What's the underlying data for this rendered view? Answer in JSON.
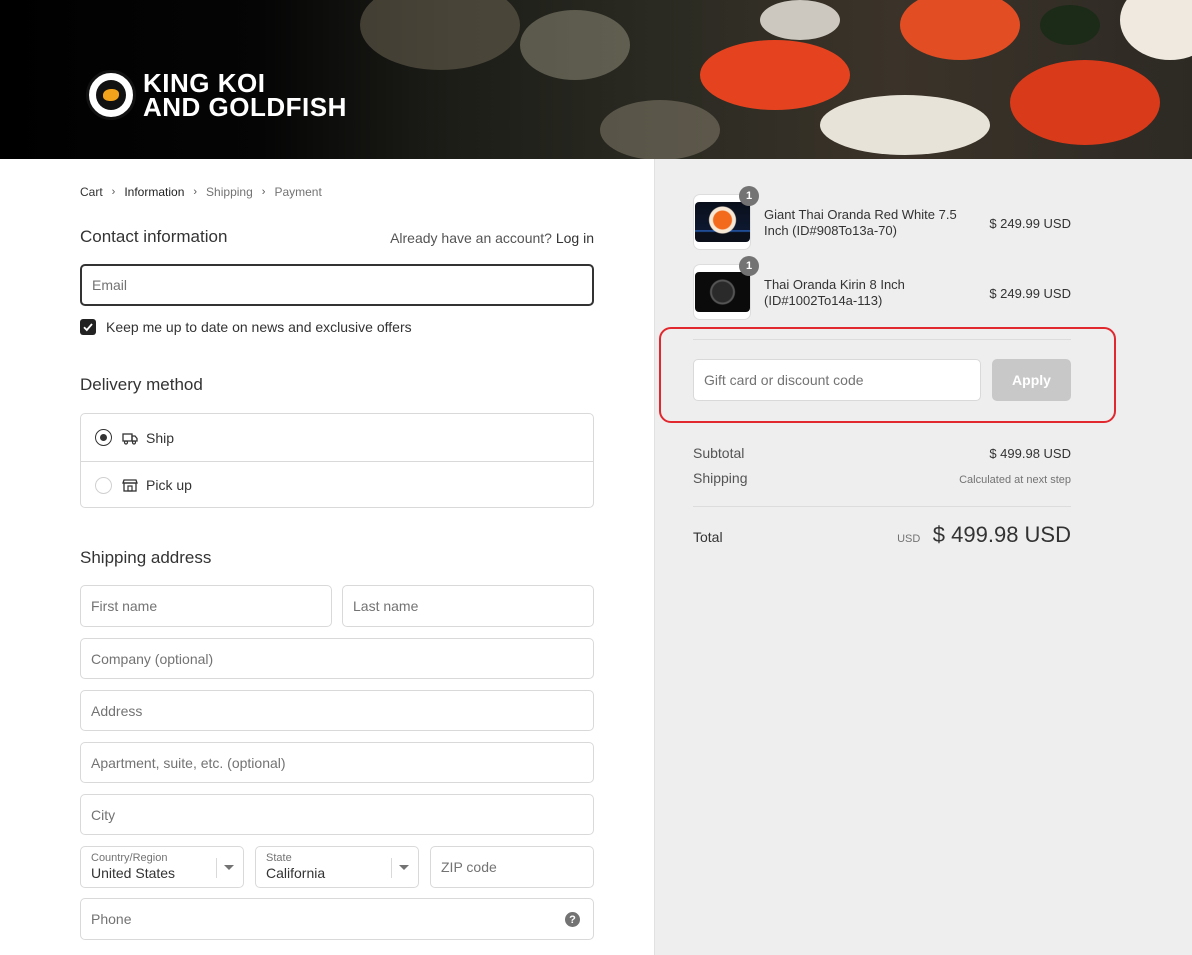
{
  "brand": {
    "line1": "KING KOI",
    "line2": "AND GOLDFISH"
  },
  "breadcrumb": {
    "cart": "Cart",
    "information": "Information",
    "shipping": "Shipping",
    "payment": "Payment"
  },
  "contact": {
    "title": "Contact information",
    "account_prompt": "Already have an account?",
    "login_label": "Log in",
    "email_placeholder": "Email",
    "newsletter_label": "Keep me up to date on news and exclusive offers",
    "newsletter_checked": true
  },
  "delivery": {
    "title": "Delivery method",
    "options": [
      {
        "label": "Ship",
        "icon": "truck-icon",
        "selected": true
      },
      {
        "label": "Pick up",
        "icon": "store-icon",
        "selected": false
      }
    ]
  },
  "shipping_address": {
    "title": "Shipping address",
    "first_name_placeholder": "First name",
    "last_name_placeholder": "Last name",
    "company_placeholder": "Company (optional)",
    "address_placeholder": "Address",
    "apartment_placeholder": "Apartment, suite, etc. (optional)",
    "city_placeholder": "City",
    "country_label": "Country/Region",
    "country_value": "United States",
    "state_label": "State",
    "state_value": "California",
    "zip_placeholder": "ZIP code",
    "phone_placeholder": "Phone"
  },
  "order": {
    "items": [
      {
        "name": "Giant Thai Oranda Red White 7.5 Inch (ID#908To13a-70)",
        "quantity": "1",
        "price": "$ 249.99 USD"
      },
      {
        "name": "Thai Oranda Kirin 8 Inch (ID#1002To14a-113)",
        "quantity": "1",
        "price": "$ 249.99 USD"
      }
    ],
    "discount_placeholder": "Gift card or discount code",
    "apply_label": "Apply",
    "subtotal_label": "Subtotal",
    "subtotal_value": "$ 499.98 USD",
    "shipping_label": "Shipping",
    "shipping_value": "Calculated at next step",
    "total_label": "Total",
    "total_currency": "USD",
    "total_value": "$ 499.98 USD"
  },
  "colors": {
    "highlight_border": "#e0282e",
    "sidebar_bg": "#eeeeee",
    "apply_disabled": "#c8c8c8"
  }
}
